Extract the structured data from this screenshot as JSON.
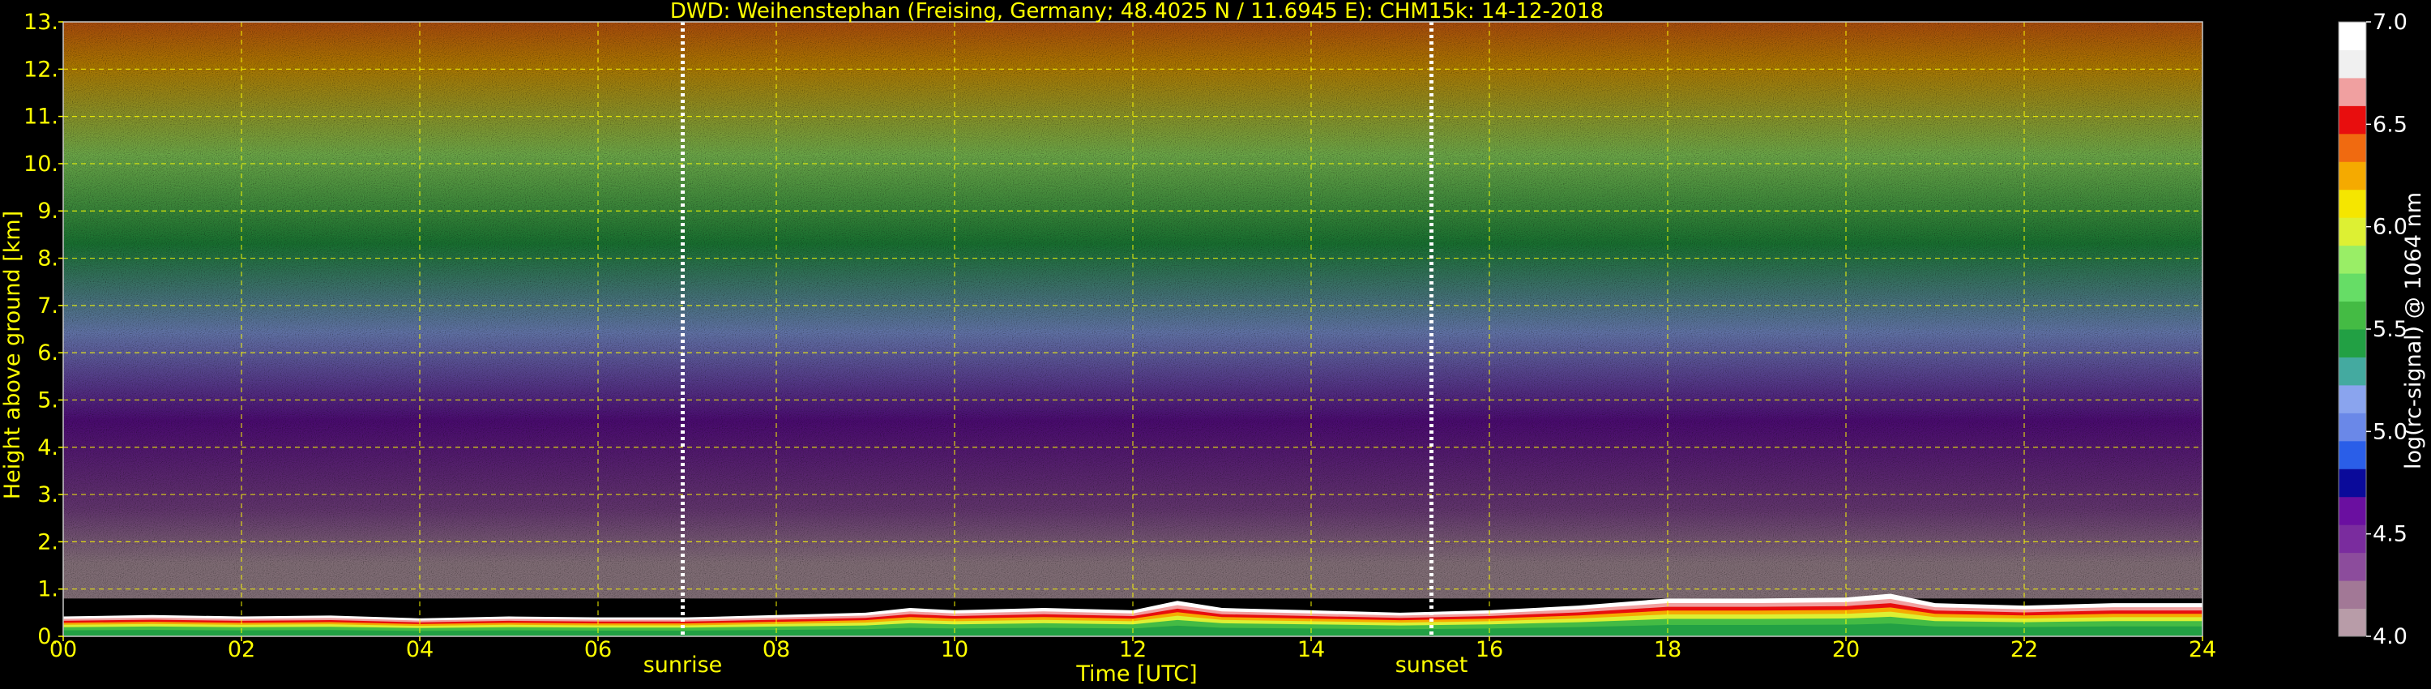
{
  "chart_data": {
    "type": "heatmap",
    "title": "DWD: Weihenstephan (Freising, Germany; 48.4025 N / 11.6945 E):    CHM15k: 14-12-2018",
    "xlabel": "Time [UTC]",
    "ylabel": "Height above ground [km]",
    "xlim": [
      0,
      24
    ],
    "ylim": [
      0,
      13
    ],
    "x_ticks": [
      "00",
      "02",
      "04",
      "06",
      "08",
      "10",
      "12",
      "14",
      "16",
      "18",
      "20",
      "22",
      "24"
    ],
    "y_ticks": [
      "0.",
      "1.",
      "2.",
      "3.",
      "4.",
      "5.",
      "6.",
      "7.",
      "8.",
      "9.",
      "10.",
      "11.",
      "12.",
      "13."
    ],
    "grid": true,
    "events": [
      {
        "label": "sunrise",
        "x": 6.95
      },
      {
        "label": "sunset",
        "x": 15.35
      }
    ],
    "colorbar": {
      "label": "log(rc-signal) @ 1064 nm",
      "range": [
        4.0,
        7.0
      ],
      "ticks": [
        "4.0",
        "4.5",
        "5.0",
        "5.5",
        "6.0",
        "6.5",
        "7.0"
      ],
      "colors": [
        "#b89ca8",
        "#a27896",
        "#8c4c9c",
        "#7a2c9e",
        "#6a0fa0",
        "#0a0a9a",
        "#2a5ee8",
        "#6a88e8",
        "#8aa4ee",
        "#44aaa0",
        "#22a044",
        "#44bb44",
        "#66dd66",
        "#99ee66",
        "#ddf033",
        "#f5e600",
        "#f5aa00",
        "#f06a10",
        "#e80e0e",
        "#f0a0a0",
        "#f0f0f0",
        "#ffffff"
      ]
    },
    "boundary_layer_top_km": [
      [
        0,
        0.42
      ],
      [
        1,
        0.45
      ],
      [
        2,
        0.42
      ],
      [
        3,
        0.44
      ],
      [
        4,
        0.38
      ],
      [
        5,
        0.42
      ],
      [
        6,
        0.4
      ],
      [
        7,
        0.4
      ],
      [
        8,
        0.45
      ],
      [
        9,
        0.5
      ],
      [
        9.5,
        0.6
      ],
      [
        10,
        0.55
      ],
      [
        11,
        0.6
      ],
      [
        12,
        0.55
      ],
      [
        12.5,
        0.75
      ],
      [
        13,
        0.6
      ],
      [
        14,
        0.55
      ],
      [
        15,
        0.5
      ],
      [
        16,
        0.55
      ],
      [
        17,
        0.65
      ],
      [
        18,
        0.8
      ],
      [
        19,
        0.8
      ],
      [
        20,
        0.82
      ],
      [
        20.5,
        0.9
      ],
      [
        21,
        0.7
      ],
      [
        22,
        0.65
      ],
      [
        23,
        0.7
      ],
      [
        24,
        0.7
      ]
    ],
    "background_signal_by_height_km": [
      [
        0.8,
        4.1
      ],
      [
        2,
        4.3
      ],
      [
        4,
        4.6
      ],
      [
        6,
        5.1
      ],
      [
        8,
        5.4
      ],
      [
        10,
        5.8
      ],
      [
        12,
        6.2
      ],
      [
        13,
        6.4
      ]
    ]
  }
}
